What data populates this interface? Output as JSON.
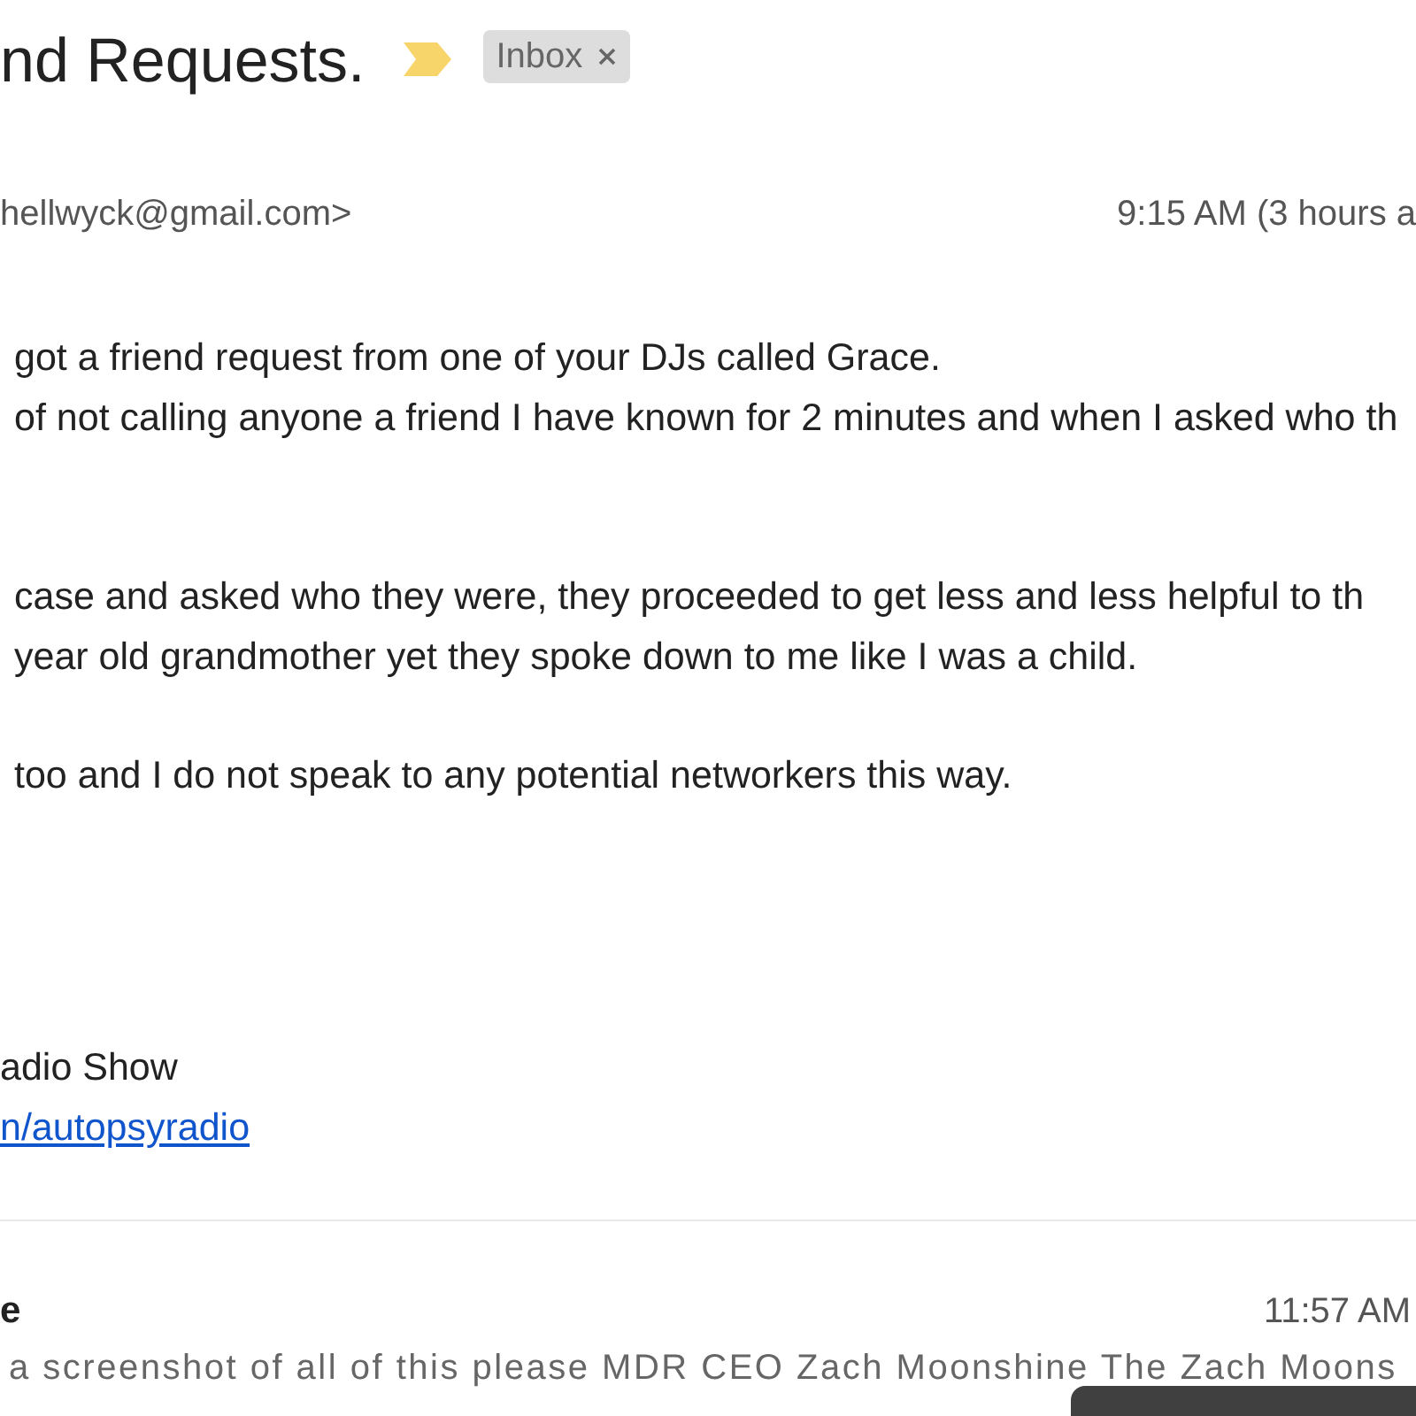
{
  "subject": {
    "title": "nd Requests.",
    "important": true,
    "labels": [
      {
        "text": "Inbox"
      }
    ]
  },
  "messages": [
    {
      "kind": "expanded",
      "sender": "hellwyck@gmail.com>",
      "time": "9:15 AM (3 hours a",
      "paragraphs": [
        [
          "got a friend request from one of your DJs called Grace.",
          "of not calling anyone a friend I have known for 2 minutes and when I asked who th"
        ],
        [
          "case and asked who they were, they proceeded to get less and less helpful to th",
          "year old grandmother yet they spoke down to me like I was a child."
        ],
        [
          "too and I do not speak to any potential networkers this way."
        ]
      ],
      "signature": [
        {
          "kind": "text",
          "text": "adio Show"
        },
        {
          "kind": "link",
          "text": "n/autopsyradio"
        }
      ]
    },
    {
      "kind": "collapsed",
      "sender": "e",
      "time": "11:57 AM",
      "snippet": "a screenshot of all of this please MDR CEO Zach Moonshine The Zach Moons"
    }
  ]
}
